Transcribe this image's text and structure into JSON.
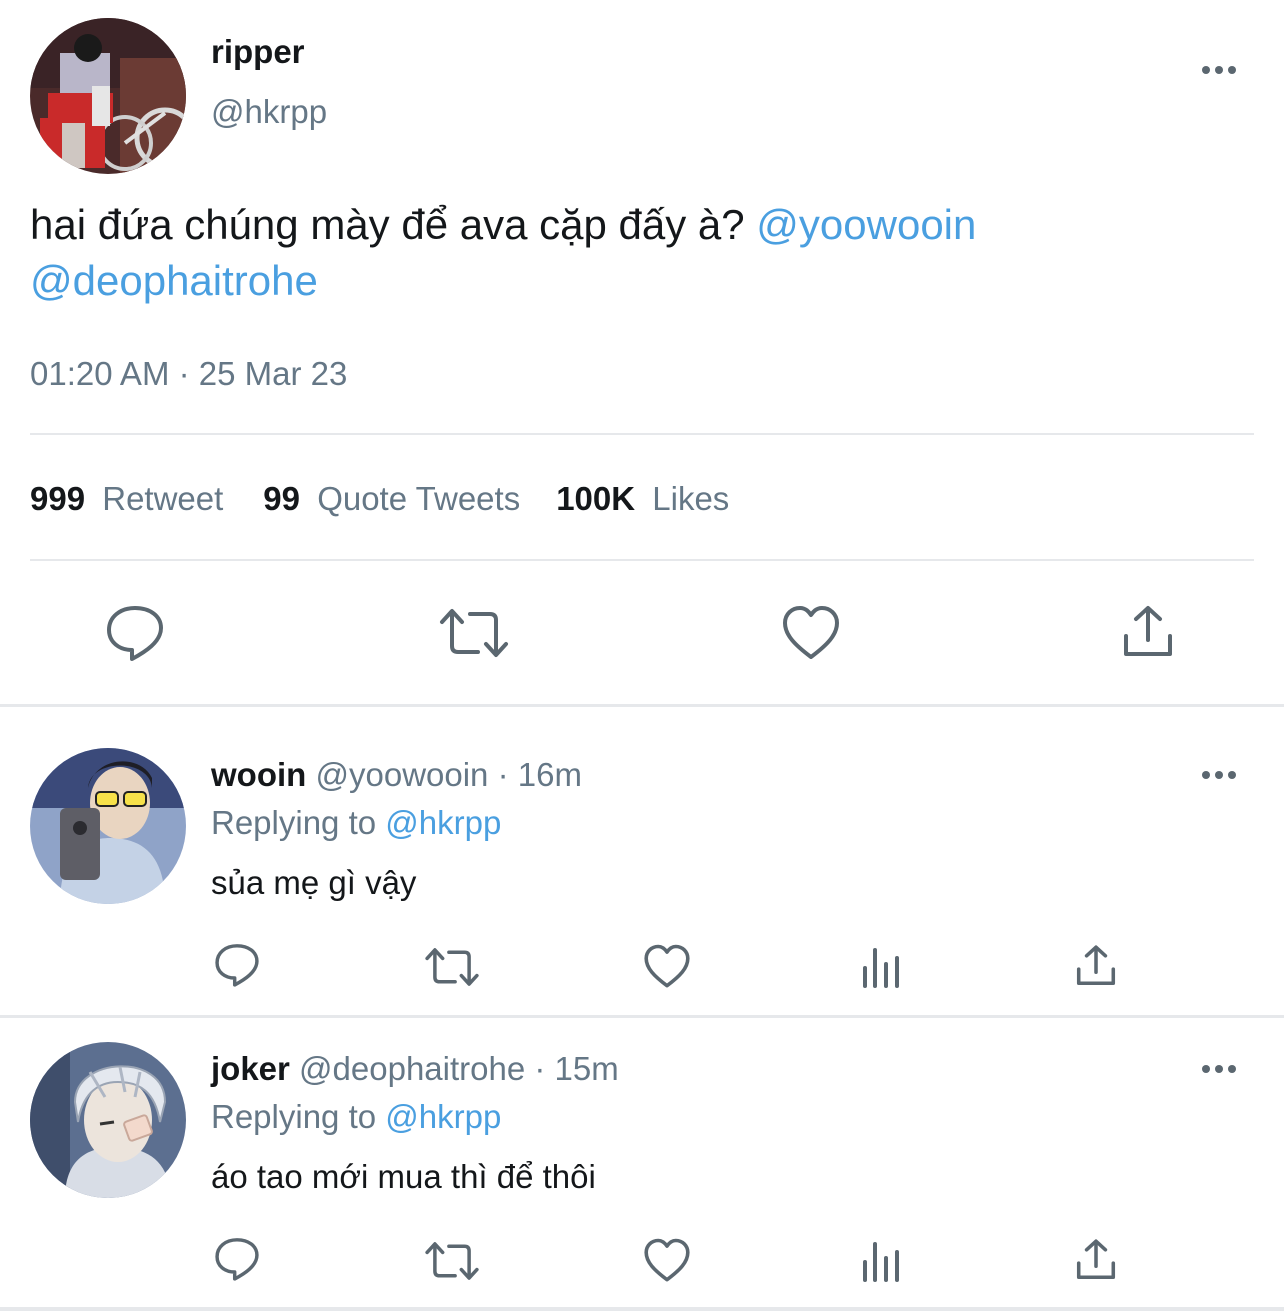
{
  "tweet": {
    "author_name": "ripper",
    "author_handle": "@hkrpp",
    "text": "hai đứa chúng mày để ava cặp đấy à?",
    "mention_1": "@yoowooin",
    "mention_2": "@deophaitrohe",
    "timestamp": "01:20 AM · 25 Mar 23",
    "stats": {
      "retweet_count": "999",
      "retweet_label": "Retweet",
      "quote_count": "99",
      "quote_label": "Quote Tweets",
      "likes_count": "100K",
      "likes_label": "Likes"
    }
  },
  "replies": [
    {
      "name": "wooin",
      "handle": "@yoowooin",
      "time": "· 16m",
      "replying_label": "Replying to",
      "replying_to": "@hkrpp",
      "text": "sủa mẹ gì vậy"
    },
    {
      "name": "joker",
      "handle": "@deophaitrohe",
      "time": "· 15m",
      "replying_label": "Replying to",
      "replying_to": "@hkrpp",
      "text": "áo tao mới mua thì để thôi"
    }
  ],
  "icons": {
    "reply": "speech-bubble-icon",
    "retweet": "retweet-arrows-icon",
    "like": "heart-icon",
    "views": "bar-chart-icon",
    "share": "share-upload-icon",
    "more": "three-dots-icon"
  },
  "colors": {
    "link": "#4a9fe0",
    "muted": "#657786",
    "icon": "#5b6770",
    "divider": "#e6e8eb"
  }
}
